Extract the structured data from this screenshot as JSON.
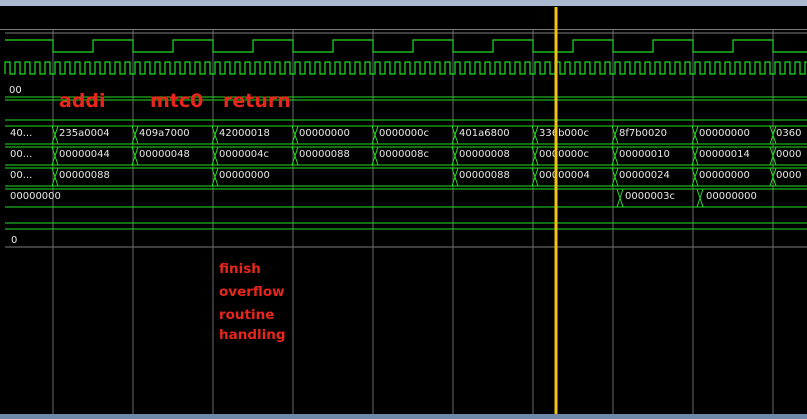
{
  "waveform": {
    "colors": {
      "background": "#000000",
      "signal": "#22dd22",
      "text": "#e8e8e8",
      "grid": "#6a6a6a",
      "cursor": "#f1c40f",
      "annotation": "#e8261c"
    },
    "row0_value": "00",
    "row1_values": [
      "40...",
      "235a0004",
      "409a7000",
      "42000018",
      "00000000",
      "0000000c",
      "401a6800",
      "336b000c",
      "8f7b0020",
      "00000000",
      "0360"
    ],
    "row2_values": [
      "00...",
      "00000044",
      "00000048",
      "0000004c",
      "00000088",
      "0000008c",
      "00000008",
      "0000000c",
      "00000010",
      "00000014",
      "0000"
    ],
    "row3_values": [
      "00...",
      "00000088",
      "00000000",
      "00000088",
      "00000004",
      "00000024",
      "00000000",
      "0000"
    ],
    "row4_values": [
      "00000000",
      "0000003c",
      "00000000"
    ],
    "row5_value": "0"
  },
  "annotations": {
    "instr_labels": [
      "addi",
      "mtc0",
      "return"
    ],
    "note_lines": [
      "finish",
      "overflow",
      "routine",
      "handling"
    ]
  }
}
